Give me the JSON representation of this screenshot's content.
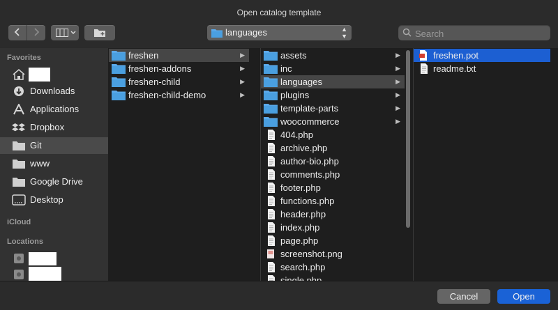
{
  "window": {
    "title": "Open catalog template"
  },
  "toolbar": {
    "path_label": "languages",
    "search_placeholder": "Search"
  },
  "sidebar": {
    "favorites_label": "Favorites",
    "favorites": [
      {
        "name": "home",
        "label": "",
        "icon": "home-icon"
      },
      {
        "name": "downloads",
        "label": "Downloads",
        "icon": "downloads-icon"
      },
      {
        "name": "applications",
        "label": "Applications",
        "icon": "applications-icon"
      },
      {
        "name": "dropbox",
        "label": "Dropbox",
        "icon": "dropbox-icon"
      },
      {
        "name": "git",
        "label": "Git",
        "icon": "folder-icon",
        "selected": true
      },
      {
        "name": "www",
        "label": "www",
        "icon": "folder-icon"
      },
      {
        "name": "google-drive",
        "label": "Google Drive",
        "icon": "folder-icon"
      },
      {
        "name": "desktop",
        "label": "Desktop",
        "icon": "desktop-icon"
      }
    ],
    "icloud_label": "iCloud",
    "locations_label": "Locations"
  },
  "columns": {
    "col1": [
      {
        "label": "freshen",
        "type": "folder",
        "selected": true
      },
      {
        "label": "freshen-addons",
        "type": "folder"
      },
      {
        "label": "freshen-child",
        "type": "folder"
      },
      {
        "label": "freshen-child-demo",
        "type": "folder"
      }
    ],
    "col2": [
      {
        "label": "assets",
        "type": "folder"
      },
      {
        "label": "inc",
        "type": "folder"
      },
      {
        "label": "languages",
        "type": "folder",
        "selected": true
      },
      {
        "label": "plugins",
        "type": "folder"
      },
      {
        "label": "template-parts",
        "type": "folder"
      },
      {
        "label": "woocommerce",
        "type": "folder"
      },
      {
        "label": "404.php",
        "type": "file"
      },
      {
        "label": "archive.php",
        "type": "file"
      },
      {
        "label": "author-bio.php",
        "type": "file"
      },
      {
        "label": "comments.php",
        "type": "file"
      },
      {
        "label": "footer.php",
        "type": "file"
      },
      {
        "label": "functions.php",
        "type": "file"
      },
      {
        "label": "header.php",
        "type": "file"
      },
      {
        "label": "index.php",
        "type": "file"
      },
      {
        "label": "page.php",
        "type": "file"
      },
      {
        "label": "screenshot.png",
        "type": "image"
      },
      {
        "label": "search.php",
        "type": "file"
      },
      {
        "label": "single.php",
        "type": "file"
      }
    ],
    "col3": [
      {
        "label": "freshen.pot",
        "type": "pot",
        "active": true
      },
      {
        "label": "readme.txt",
        "type": "file"
      }
    ]
  },
  "buttons": {
    "cancel": "Cancel",
    "open": "Open"
  },
  "colors": {
    "accent": "#1a62d6",
    "folder": "#4a9fe0"
  }
}
